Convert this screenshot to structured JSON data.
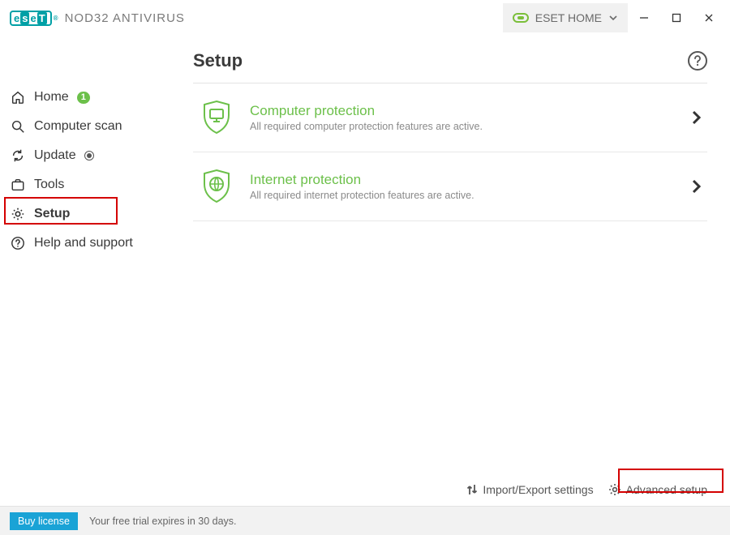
{
  "brand": {
    "product": "NOD32 ANTIVIRUS"
  },
  "esetHome": {
    "label": "ESET HOME"
  },
  "nav": {
    "home": {
      "label": "Home",
      "badge": "1"
    },
    "scan": {
      "label": "Computer scan"
    },
    "update": {
      "label": "Update"
    },
    "tools": {
      "label": "Tools"
    },
    "setup": {
      "label": "Setup"
    },
    "help": {
      "label": "Help and support"
    }
  },
  "page": {
    "title": "Setup"
  },
  "cards": {
    "computer": {
      "title": "Computer protection",
      "subtitle": "All required computer protection features are active."
    },
    "internet": {
      "title": "Internet protection",
      "subtitle": "All required internet protection features are active."
    }
  },
  "bottom": {
    "importExport": "Import/Export settings",
    "advanced": "Advanced setup"
  },
  "status": {
    "buy": "Buy license",
    "trial": "Your free trial expires in 30 days."
  }
}
